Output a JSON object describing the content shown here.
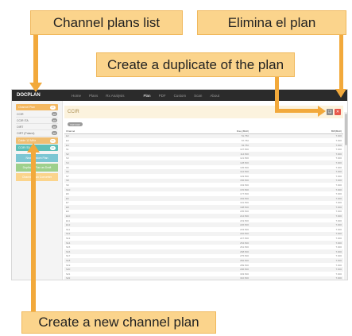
{
  "annotations": {
    "channel_plans_list": "Channel plans list",
    "elimina_el_plan": "Elimina el plan",
    "create_duplicate": "Create a duplicate of the plan",
    "create_new_plan": "Create a new channel plan"
  },
  "colors": {
    "callout_fill": "#fbd48c",
    "arrow": "#f2a93b",
    "topbar": "#2b2b2b",
    "plan_active": "#f4b860",
    "plan_secondary": "#f0be72",
    "new_plan": "#7cc6d3",
    "duplicate_green": "#9ed08c",
    "import_orange": "#fbd48c",
    "delete_red": "#e8574a"
  },
  "app": {
    "logo": "DOCPLAN",
    "nav": [
      "Home",
      "Plans",
      "Rx Analysis",
      "Plan",
      "PDF",
      "Custom",
      "Scan",
      "About"
    ],
    "sidebar": {
      "active_plan": {
        "label": "Channel Plan",
        "count": "16"
      },
      "plans": [
        {
          "label": "CCIR",
          "count": "48"
        },
        {
          "label": "CCIR ITA",
          "count": "48"
        },
        {
          "label": "OIRT",
          "count": "48"
        },
        {
          "label": "OIRT (Poland)",
          "count": "48"
        }
      ],
      "plan_orange": {
        "label": "Cable 12 MHz",
        "count": "50"
      },
      "plan_teal": {
        "label": "CCIR ITA",
        "count": "42"
      },
      "new_plan_button": "New Custom Plan",
      "duplicate_button": "Duplicate Plan as Draft",
      "import_button": "Channel Plan Converter"
    },
    "plan": {
      "title": "CCIR",
      "tag": "VHF/UHF",
      "columns": [
        "Channel",
        "Freq (MHz)",
        "BW(MHz)"
      ],
      "rows": [
        [
          "E2",
          "51.750",
          "7.000"
        ],
        [
          "E3",
          "57.750",
          "7.000"
        ],
        [
          "E4",
          "63.750",
          "7.000"
        ],
        [
          "S1",
          "107.500",
          "7.000"
        ],
        [
          "S2",
          "114.500",
          "7.000"
        ],
        [
          "S3",
          "121.500",
          "7.000"
        ],
        [
          "S4",
          "128.500",
          "7.000"
        ],
        [
          "S5",
          "135.500",
          "7.000"
        ],
        [
          "S6",
          "142.500",
          "7.000"
        ],
        [
          "S7",
          "149.500",
          "7.000"
        ],
        [
          "S8",
          "156.500",
          "7.000"
        ],
        [
          "S9",
          "163.500",
          "7.000"
        ],
        [
          "S10",
          "170.500",
          "7.000"
        ],
        [
          "E5",
          "177.500",
          "7.000"
        ],
        [
          "E6",
          "184.500",
          "7.000"
        ],
        [
          "E7",
          "191.500",
          "7.000"
        ],
        [
          "E8",
          "198.500",
          "7.000"
        ],
        [
          "E9",
          "205.500",
          "7.000"
        ],
        [
          "E10",
          "212.500",
          "7.000"
        ],
        [
          "E11",
          "219.500",
          "7.000"
        ],
        [
          "E12",
          "226.500",
          "7.000"
        ],
        [
          "S11",
          "233.500",
          "7.000"
        ],
        [
          "S12",
          "240.500",
          "7.000"
        ],
        [
          "S13",
          "247.500",
          "7.000"
        ],
        [
          "S14",
          "254.500",
          "7.000"
        ],
        [
          "S15",
          "261.500",
          "7.000"
        ],
        [
          "S16",
          "268.500",
          "7.000"
        ],
        [
          "S17",
          "275.500",
          "7.000"
        ],
        [
          "S18",
          "282.500",
          "7.000"
        ],
        [
          "S19",
          "289.500",
          "7.000"
        ],
        [
          "S20",
          "296.500",
          "7.000"
        ],
        [
          "S21",
          "303.500",
          "7.000"
        ],
        [
          "S22",
          "310.500",
          "7.000"
        ],
        [
          "S23",
          "317.500",
          "7.000"
        ],
        [
          "S24",
          "324.500",
          "7.000"
        ]
      ]
    }
  }
}
